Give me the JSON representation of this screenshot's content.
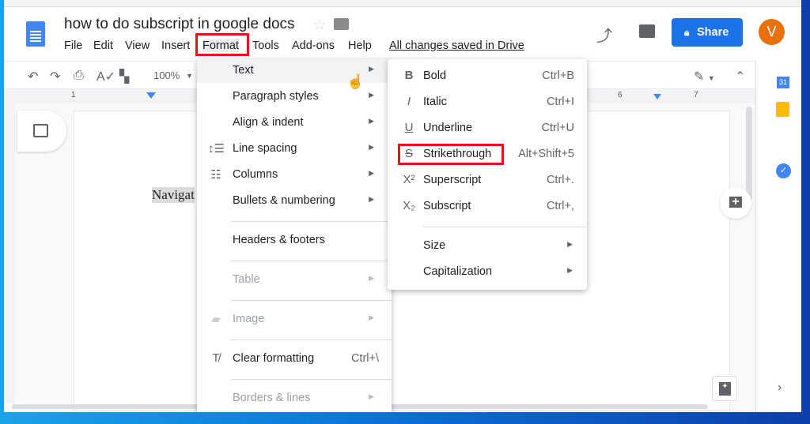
{
  "document": {
    "title": "how to do subscript in google docs",
    "body_text": "Navigat"
  },
  "menubar": [
    "File",
    "Edit",
    "View",
    "Insert",
    "Format",
    "Tools",
    "Add-ons",
    "Help"
  ],
  "save_status": "All changes saved in Drive",
  "share_label": "Share",
  "avatar_initial": "V",
  "toolbar": {
    "zoom": "100%"
  },
  "ruler": {
    "marks": [
      "1",
      "6",
      "7"
    ]
  },
  "format_menu": [
    {
      "label": "Text",
      "arrow": true,
      "highlighted": true
    },
    {
      "label": "Paragraph styles",
      "arrow": true
    },
    {
      "label": "Align & indent",
      "arrow": true
    },
    {
      "label": "Line spacing",
      "arrow": true,
      "icon": "line-spacing-icon"
    },
    {
      "label": "Columns",
      "arrow": true,
      "icon": "columns-icon"
    },
    {
      "label": "Bullets & numbering",
      "arrow": true
    },
    {
      "sep": true
    },
    {
      "label": "Headers & footers"
    },
    {
      "sep": true
    },
    {
      "label": "Table",
      "arrow": true,
      "disabled": true
    },
    {
      "sep": true
    },
    {
      "label": "Image",
      "arrow": true,
      "disabled": true,
      "icon": "image-icon"
    },
    {
      "sep": true
    },
    {
      "label": "Clear formatting",
      "shortcut": "Ctrl+\\",
      "icon": "clear-formatting-icon"
    },
    {
      "sep": true
    },
    {
      "label": "Borders & lines",
      "arrow": true,
      "disabled": true
    }
  ],
  "text_submenu": [
    {
      "label": "Bold",
      "shortcut": "Ctrl+B",
      "icon": "bold-icon",
      "glyph": "B"
    },
    {
      "label": "Italic",
      "shortcut": "Ctrl+I",
      "icon": "italic-icon",
      "glyph": "I"
    },
    {
      "label": "Underline",
      "shortcut": "Ctrl+U",
      "icon": "underline-icon",
      "glyph": "U"
    },
    {
      "label": "Strikethrough",
      "shortcut": "Alt+Shift+5",
      "icon": "strikethrough-icon",
      "glyph": "S",
      "highlighted": true
    },
    {
      "label": "Superscript",
      "shortcut": "Ctrl+.",
      "icon": "superscript-icon",
      "glyph": "X²"
    },
    {
      "label": "Subscript",
      "shortcut": "Ctrl+,",
      "icon": "subscript-icon",
      "glyph": "X₂"
    },
    {
      "sep": true
    },
    {
      "label": "Size",
      "arrow": true
    },
    {
      "label": "Capitalization",
      "arrow": true
    }
  ],
  "colors": {
    "accent": "#1a73e8",
    "highlight": "#e5121b",
    "avatar": "#e8710a"
  }
}
